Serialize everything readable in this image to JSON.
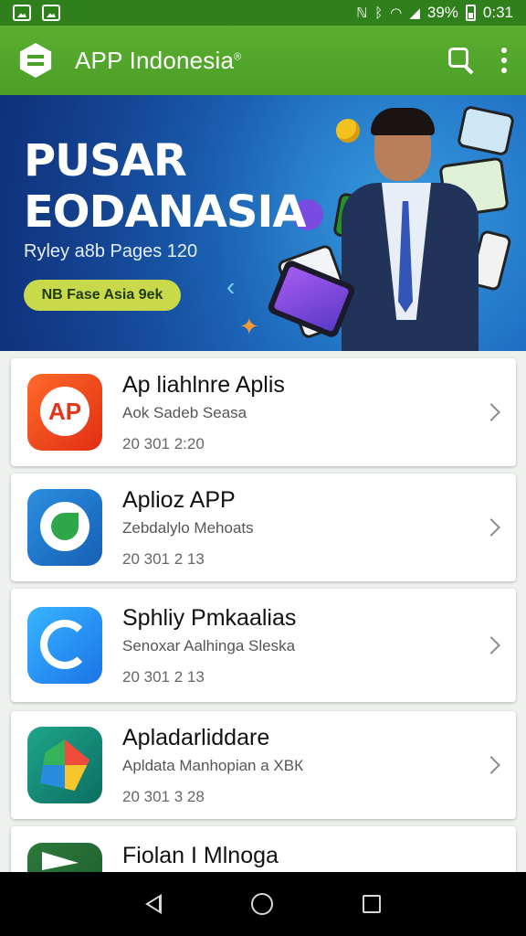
{
  "status_bar": {
    "battery": "39%",
    "time": "0:31",
    "icons": [
      "gallery-icon",
      "photo-icon",
      "nfc-icon",
      "bluetooth-icon",
      "wifi-icon",
      "signal-icon",
      "battery-icon"
    ]
  },
  "app_bar": {
    "title": "APP Indonesia",
    "trademark": "®",
    "actions": [
      "search-icon",
      "more-icon"
    ],
    "colors": {
      "bar": "#4c9f27",
      "status": "#2f7f1c"
    }
  },
  "banner": {
    "title_line1": "PUSAR",
    "title_line2": "EODANASIA",
    "subtitle": "Ryley a8b Pages 120",
    "cta": "NB Fase Asia 9ek"
  },
  "apps": [
    {
      "name": "Ap liahlnre Aplis",
      "subtitle": "Aok Sadeb Seasa",
      "date": "20 301 2:20",
      "icon": "ap-icon",
      "icon_text": "AP"
    },
    {
      "name": "Aplioz APP",
      "subtitle": "Zebdalylo Mehoats",
      "date": "20 301 2 13",
      "icon": "leaf-icon"
    },
    {
      "name": "Sphliy Pmkaalias",
      "subtitle": "Senoxar Aalhinga Sleska",
      "date": "20 301 2 13",
      "icon": "sync-icon"
    },
    {
      "name": "Apladarliddare",
      "subtitle": "Apldata Manhopian a ХВК",
      "date": "20 301 3 28",
      "icon": "star-icon"
    },
    {
      "name": "Fiolan I Mlnoga",
      "subtitle": "",
      "date": "",
      "icon": "play-icon"
    }
  ]
}
